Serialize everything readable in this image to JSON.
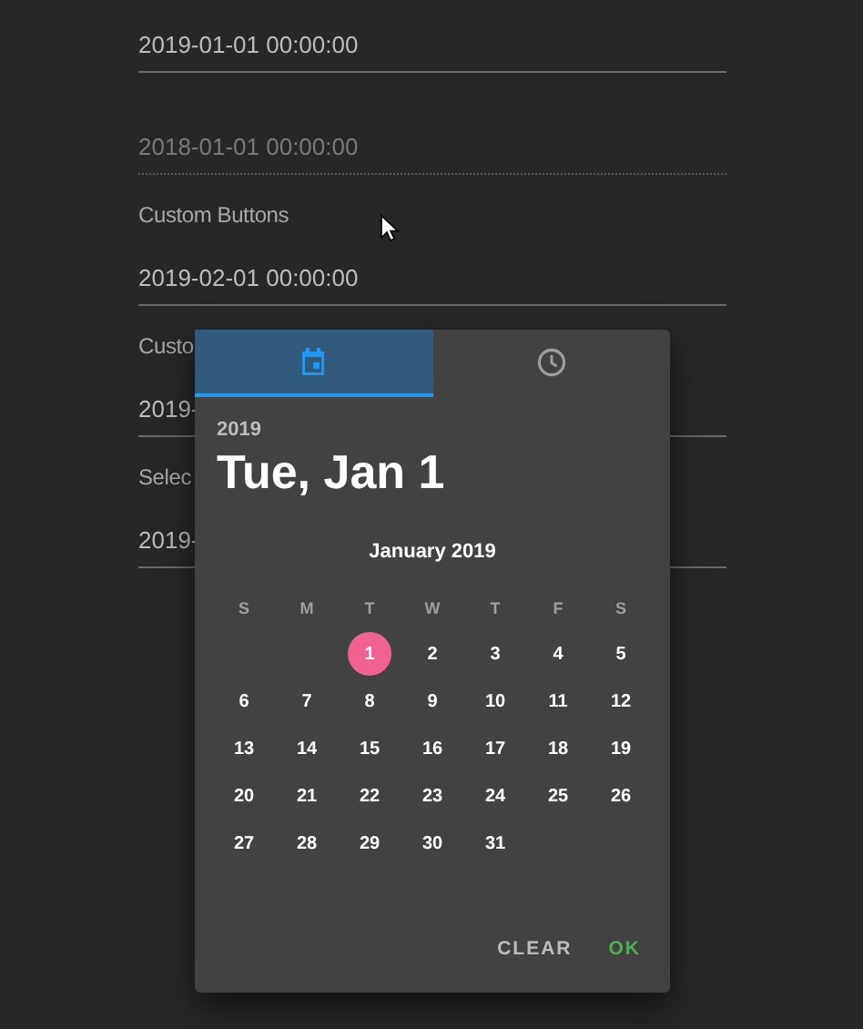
{
  "fields": [
    {
      "kind": "value",
      "value": "2019-01-01 00:00:00"
    },
    {
      "kind": "disabled",
      "value": "2018-01-01 00:00:00"
    },
    {
      "kind": "value",
      "label": "Custom Buttons",
      "value": "2019-02-01 00:00:00"
    },
    {
      "kind": "value",
      "label": "Custo",
      "value": "2019-"
    },
    {
      "kind": "value",
      "label": "Selec",
      "value": "2019-"
    }
  ],
  "picker": {
    "tabs": [
      {
        "kind": "date",
        "selected": true
      },
      {
        "kind": "time",
        "selected": false
      }
    ],
    "year": "2019",
    "date": "Tue, Jan 1",
    "month": "January 2019",
    "weekdays": [
      "S",
      "M",
      "T",
      "W",
      "T",
      "F",
      "S"
    ],
    "weeks": [
      [
        {
          "label": "1",
          "selected": true
        },
        {
          "label": "2",
          "selected": false
        },
        {
          "label": "3",
          "selected": false
        },
        {
          "label": "4",
          "selected": false
        },
        {
          "label": "5",
          "selected": false
        }
      ],
      [
        {
          "label": "6",
          "selected": false
        },
        {
          "label": "7",
          "selected": false
        },
        {
          "label": "8",
          "selected": false
        },
        {
          "label": "9",
          "selected": false
        },
        {
          "label": "10",
          "selected": false
        },
        {
          "label": "11",
          "selected": false
        },
        {
          "label": "12",
          "selected": false
        }
      ],
      [
        {
          "label": "13",
          "selected": false
        },
        {
          "label": "14",
          "selected": false
        },
        {
          "label": "15",
          "selected": false
        },
        {
          "label": "16",
          "selected": false
        },
        {
          "label": "17",
          "selected": false
        },
        {
          "label": "18",
          "selected": false
        },
        {
          "label": "19",
          "selected": false
        }
      ],
      [
        {
          "label": "20",
          "selected": false
        },
        {
          "label": "21",
          "selected": false
        },
        {
          "label": "22",
          "selected": false
        },
        {
          "label": "23",
          "selected": false
        },
        {
          "label": "24",
          "selected": false
        },
        {
          "label": "25",
          "selected": false
        },
        {
          "label": "26",
          "selected": false
        }
      ],
      [
        {
          "label": "27",
          "selected": false
        },
        {
          "label": "28",
          "selected": false
        },
        {
          "label": "29",
          "selected": false
        },
        {
          "label": "30",
          "selected": false
        },
        {
          "label": "31",
          "selected": false
        }
      ]
    ],
    "buttons": [
      {
        "kind": "clear",
        "label": "CLEAR"
      },
      {
        "kind": "ok",
        "label": "OK"
      }
    ]
  }
}
